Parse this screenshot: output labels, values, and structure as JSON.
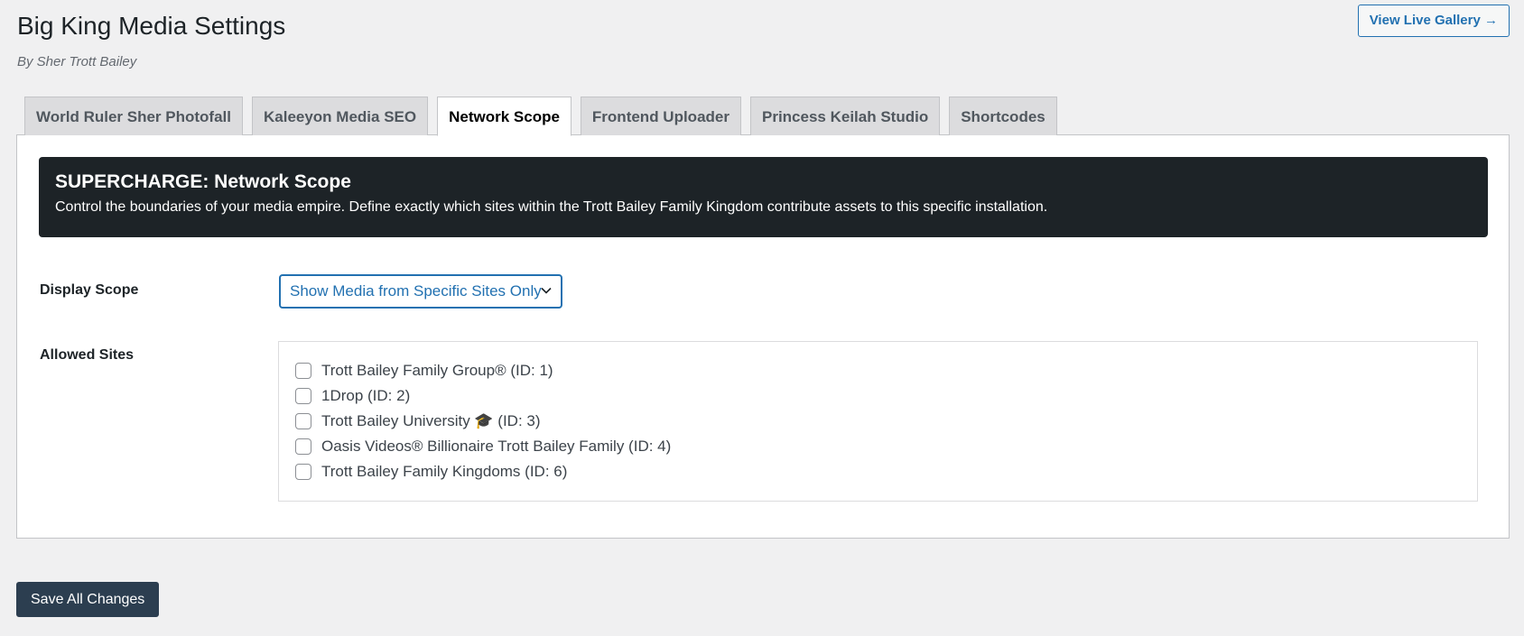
{
  "header": {
    "title": "Big King Media Settings",
    "byline": "By Sher Trott Bailey",
    "live_gallery_label": "View Live Gallery →"
  },
  "tabs": [
    {
      "label": "World Ruler Sher Photofall",
      "active": false
    },
    {
      "label": "Kaleeyon Media SEO",
      "active": false
    },
    {
      "label": "Network Scope",
      "active": true
    },
    {
      "label": "Frontend Uploader",
      "active": false
    },
    {
      "label": "Princess Keilah Studio",
      "active": false
    },
    {
      "label": "Shortcodes",
      "active": false
    }
  ],
  "banner": {
    "title": "SUPERCHARGE: Network Scope",
    "description": "Control the boundaries of your media empire. Define exactly which sites within the Trott Bailey Family Kingdom contribute assets to this specific installation."
  },
  "display_scope": {
    "label": "Display Scope",
    "selected": "Show Media from Specific Sites Only"
  },
  "allowed_sites": {
    "label": "Allowed Sites",
    "sites": [
      {
        "label": "Trott Bailey Family Group® (ID: 1)",
        "checked": false
      },
      {
        "label": "1Drop (ID: 2)",
        "checked": false
      },
      {
        "label": "Trott Bailey University 🎓 (ID: 3)",
        "checked": false
      },
      {
        "label": "Oasis Videos® Billionaire Trott Bailey Family (ID: 4)",
        "checked": false
      },
      {
        "label": "Trott Bailey Family Kingdoms (ID: 6)",
        "checked": false
      }
    ]
  },
  "footer": {
    "save_label": "Save All Changes"
  },
  "colors": {
    "accent": "#2271b1",
    "banner_bg": "#1d2327",
    "save_button_bg": "#2c3e50",
    "page_bg": "#f0f0f1"
  }
}
